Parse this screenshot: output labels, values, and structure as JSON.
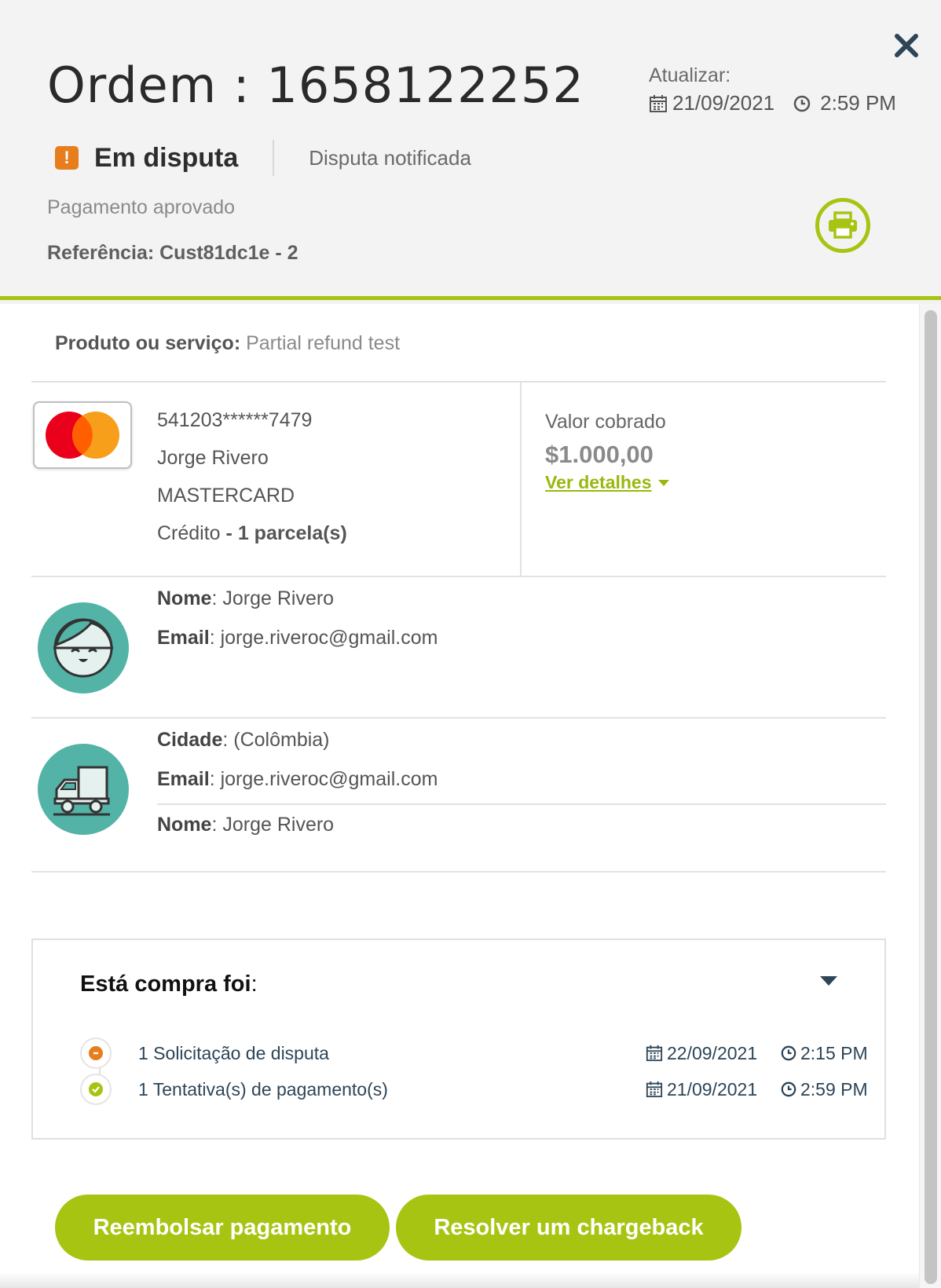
{
  "header": {
    "order_title": "Ordem : 1658122252",
    "update_label": "Atualizar:",
    "update_date": "21/09/2021",
    "update_time": "2:59 PM",
    "status_main": "Em disputa",
    "status_sub": "Disputa notificada",
    "payment_status": "Pagamento aprovado",
    "reference": "Referência: Cust81dc1e - 2",
    "close_icon": "close-icon",
    "print_icon": "printer-icon"
  },
  "product": {
    "label": "Produto ou serviço",
    "separator": ":",
    "value": "Partial refund test"
  },
  "card": {
    "number": "541203******7479",
    "holder": "Jorge Rivero",
    "brand": "MASTERCARD",
    "type": "Crédito",
    "installments": "- 1 parcela(s)",
    "charged_label": "Valor cobrado",
    "charged_value": "$1.000,00",
    "details_link": "Ver detalhes"
  },
  "buyer": {
    "name_label": "Nome",
    "name_value": ": Jorge Rivero",
    "email_label": "Email",
    "email_value": ": jorge.riveroc@gmail.com"
  },
  "shipping": {
    "city_label": "Cidade",
    "city_value": ": (Colômbia)",
    "email_label": "Email",
    "email_value": ": jorge.riveroc@gmail.com",
    "name_label": "Nome",
    "name_value": ": Jorge Rivero"
  },
  "purchase": {
    "title": "Está compra foi",
    "title_suffix": ":",
    "events": [
      {
        "text": "1 Solicitação de disputa",
        "date": "22/09/2021",
        "time": "2:15 PM",
        "status": "dispute",
        "color": "#e67e1e"
      },
      {
        "text": "1 Tentativa(s) de pagamento(s)",
        "date": "21/09/2021",
        "time": "2:59 PM",
        "status": "approved",
        "color": "#a8c412"
      }
    ]
  },
  "actions": {
    "refund": "Reembolsar pagamento",
    "chargeback": "Resolver um chargeback"
  },
  "colors": {
    "accent": "#a8c412",
    "warning": "#e67e1e",
    "avatar_bg": "#52b3a6",
    "timeline_text": "#2d4557"
  }
}
